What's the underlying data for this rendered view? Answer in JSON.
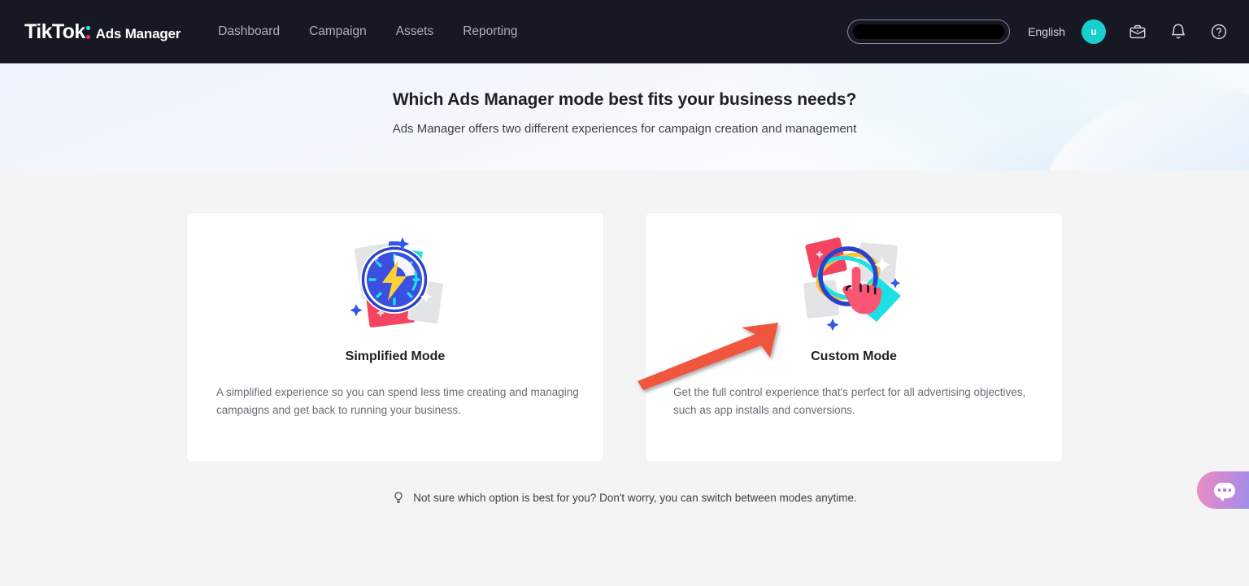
{
  "header": {
    "logo": {
      "primary": "TikTok",
      "secondary": "Ads Manager"
    },
    "nav": [
      {
        "label": "Dashboard",
        "name": "nav-dashboard"
      },
      {
        "label": "Campaign",
        "name": "nav-campaign"
      },
      {
        "label": "Assets",
        "name": "nav-assets"
      },
      {
        "label": "Reporting",
        "name": "nav-reporting"
      }
    ],
    "search": {
      "value": "",
      "placeholder": ""
    },
    "language": "English",
    "avatar_initial": "u",
    "icons": [
      "briefcase-icon",
      "bell-icon",
      "help-circle-icon"
    ]
  },
  "hero": {
    "title": "Which Ads Manager mode best fits your business needs?",
    "subtitle": "Ads Manager offers two different experiences for campaign creation and management"
  },
  "cards": [
    {
      "name": "simplified-mode-card",
      "art": "stopwatch-lightning-illustration",
      "title": "Simplified Mode",
      "description": "A simplified experience so you can spend less time creating and managing campaigns and get back to running your business."
    },
    {
      "name": "custom-mode-card",
      "art": "globe-hand-cursor-illustration",
      "title": "Custom Mode",
      "description": "Get the full control experience that's perfect for all advertising objectives, such as app installs and conversions."
    }
  ],
  "footnote": {
    "icon": "lightbulb-icon",
    "text": "Not sure which option is best for you? Don't worry, you can switch between modes anytime."
  },
  "annotation": {
    "name": "red-arrow-pointer",
    "color": "#f0553c",
    "points_to": "custom-mode-card"
  },
  "chat_widget": {
    "name": "chat-support-button",
    "icon": "chat-bubble-icon",
    "gradient_from": "#ef8cc0",
    "gradient_to": "#9d8fe8"
  },
  "colors": {
    "header_bg": "#161823",
    "page_bg": "#f4f4f4",
    "card_bg": "#ffffff",
    "accent_cyan": "#25f4ee",
    "accent_pink": "#fe2c55",
    "avatar_teal": "#17cfcf"
  }
}
